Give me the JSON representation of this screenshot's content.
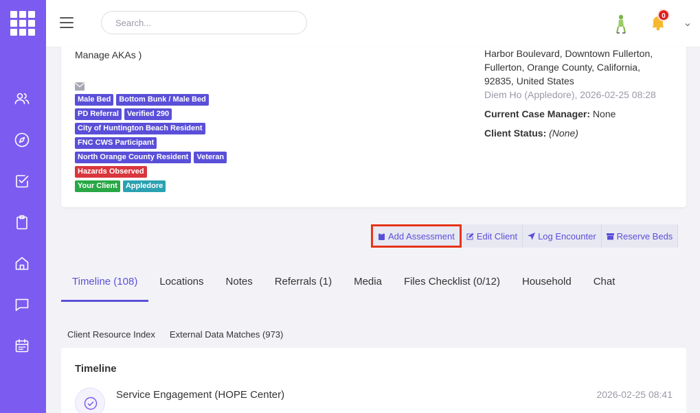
{
  "header": {
    "search_placeholder": "Search...",
    "notification_count": "0"
  },
  "client": {
    "aka_text": "Manage AKAs )",
    "tags": [
      [
        {
          "label": "Male Bed",
          "color": "#5a4fd8"
        },
        {
          "label": "Bottom Bunk / Male Bed",
          "color": "#5a4fd8"
        }
      ],
      [
        {
          "label": "PD Referral",
          "color": "#5a4fd8"
        },
        {
          "label": "Verified 290",
          "color": "#5a4fd8"
        }
      ],
      [
        {
          "label": "City of Huntington Beach Resident",
          "color": "#5a4fd8"
        }
      ],
      [
        {
          "label": "FNC CWS Participant",
          "color": "#5a4fd8"
        }
      ],
      [
        {
          "label": "North Orange County Resident",
          "color": "#5a4fd8"
        },
        {
          "label": "Veteran",
          "color": "#5a4fd8"
        }
      ],
      [
        {
          "label": "Hazards Observed",
          "color": "#d9363e"
        }
      ],
      [
        {
          "label": "Your Client",
          "color": "#28a745"
        },
        {
          "label": "Appledore",
          "color": "#2aa1b0"
        }
      ]
    ],
    "address_lines": [
      "Harbor Boulevard, Downtown Fullerton,",
      "Fullerton, Orange County, California,",
      "92835, United States"
    ],
    "address_stamp": "Diem Ho (Appledore), 2026-02-25 08:28",
    "case_manager_label": "Current Case Manager:",
    "case_manager_value": " None",
    "status_label": "Client Status:",
    "status_value": "(None)"
  },
  "actions": {
    "add_assessment": "Add Assessment",
    "edit_client": "Edit Client",
    "log_encounter": "Log Encounter",
    "reserve_beds": "Reserve Beds"
  },
  "tabs": [
    {
      "label": "Timeline (108)"
    },
    {
      "label": "Locations"
    },
    {
      "label": "Notes"
    },
    {
      "label": "Referrals (1)"
    },
    {
      "label": "Media"
    },
    {
      "label": "Files Checklist (0/12)"
    },
    {
      "label": "Household"
    },
    {
      "label": "Chat"
    }
  ],
  "subtabs": [
    {
      "label": "Client Resource Index"
    },
    {
      "label": "External Data Matches (973)"
    }
  ],
  "timeline": {
    "title": "Timeline",
    "item_title": "Service Engagement (HOPE Center)",
    "item_date": "2026-02-25 08:41"
  },
  "colors": {
    "sidebar": "#7c5cf0",
    "accent": "#5a4fd8",
    "highlight": "#e5331a"
  }
}
